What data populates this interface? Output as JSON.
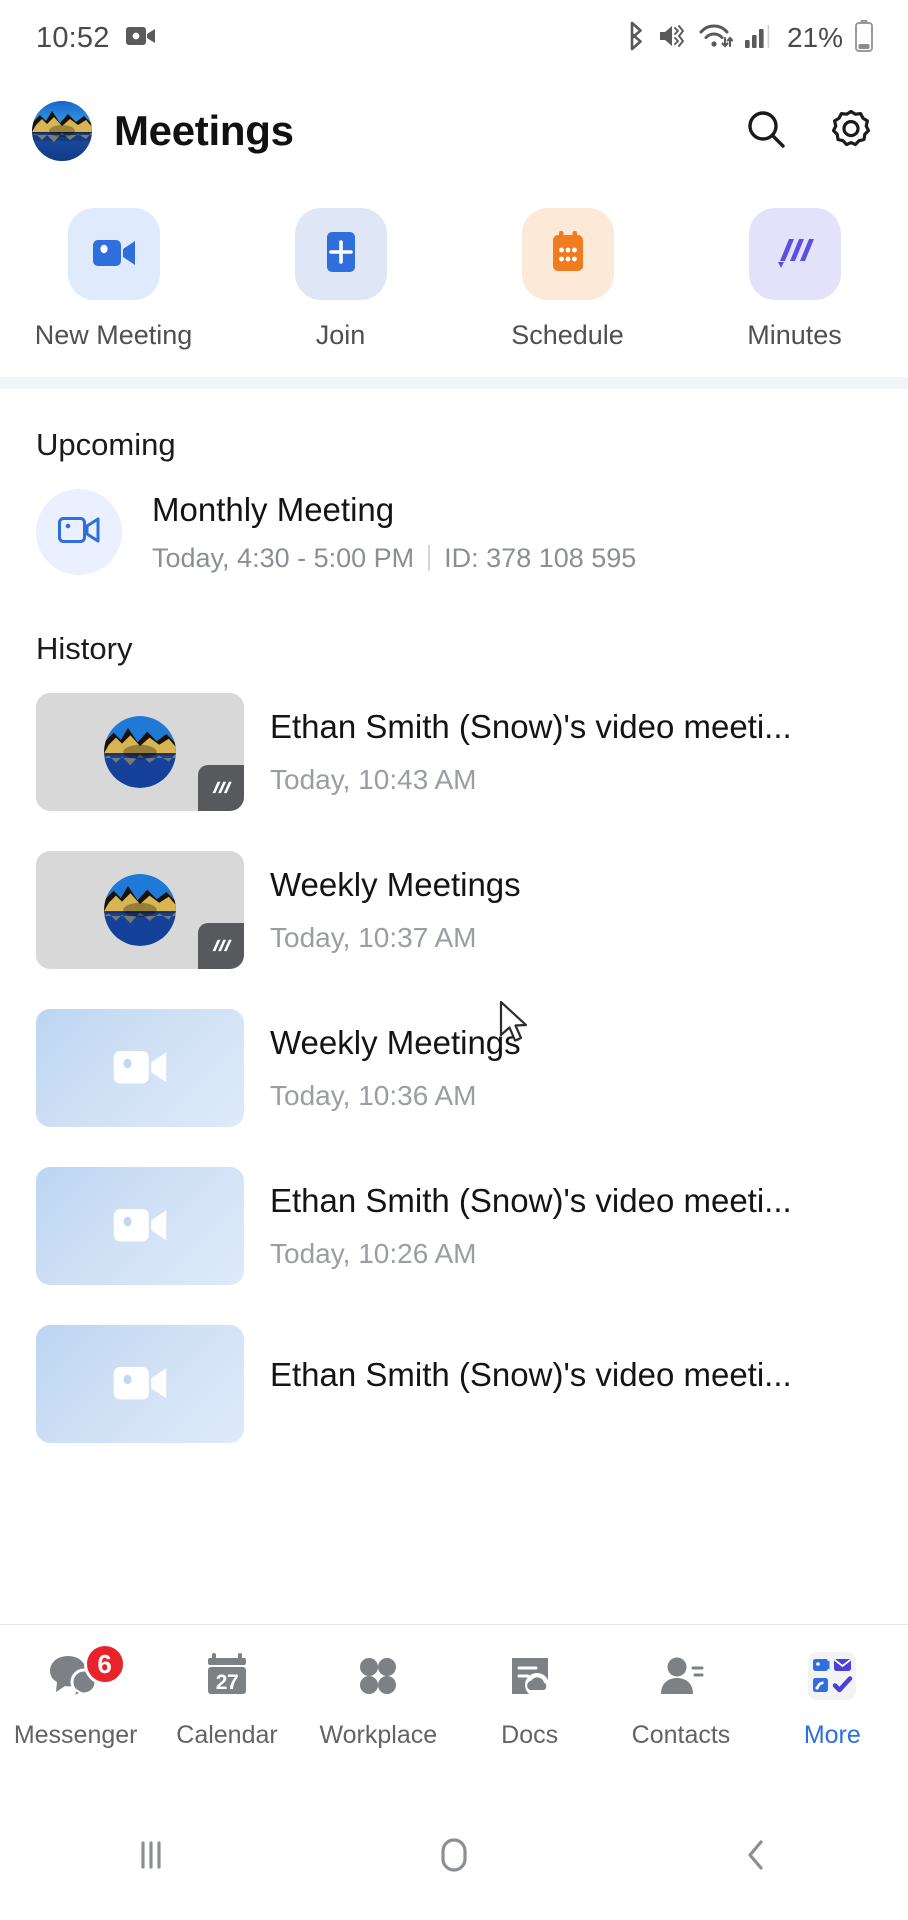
{
  "status_bar": {
    "time": "10:52",
    "battery_percent": "21%",
    "icons": [
      "video-recording-icon",
      "bluetooth-icon",
      "mute-vibrate-icon",
      "wifi-icon",
      "cellular-signal-icon",
      "battery-icon"
    ]
  },
  "header": {
    "title": "Meetings",
    "avatar_name": "user-avatar",
    "search_label": "search-icon",
    "settings_label": "gear-icon"
  },
  "quick_actions": [
    {
      "label": "New Meeting",
      "icon": "video-camera-icon",
      "tile_color": "#dfeafd",
      "icon_color": "#2f6fdd"
    },
    {
      "label": "Join",
      "icon": "plus-square-icon",
      "tile_color": "#dfe7f7",
      "icon_color": "#2f6fdd"
    },
    {
      "label": "Schedule",
      "icon": "calendar-icon",
      "tile_color": "#fde9d7",
      "icon_color": "#f07c1f"
    },
    {
      "label": "Minutes",
      "icon": "minutes-icon",
      "tile_color": "#e4e2fb",
      "icon_color": "#5b4fe0"
    }
  ],
  "upcoming": {
    "section_title": "Upcoming",
    "meeting": {
      "title": "Monthly Meeting",
      "time": "Today, 4:30 - 5:00 PM",
      "id": "ID: 378 108 595"
    }
  },
  "history": {
    "section_title": "History",
    "items": [
      {
        "title": "Ethan Smith (Snow)'s video meeti...",
        "time": "Today, 10:43 AM",
        "thumb": "gray",
        "has_avatar": true,
        "has_minutes_badge": true
      },
      {
        "title": "Weekly Meetings",
        "time": "Today, 10:37 AM",
        "thumb": "gray",
        "has_avatar": true,
        "has_minutes_badge": true
      },
      {
        "title": "Weekly Meetings",
        "time": "Today, 10:36 AM",
        "thumb": "blue",
        "has_avatar": false,
        "has_minutes_badge": false
      },
      {
        "title": "Ethan Smith (Snow)'s video meeti...",
        "time": "Today, 10:26 AM",
        "thumb": "blue",
        "has_avatar": false,
        "has_minutes_badge": false
      },
      {
        "title": "Ethan Smith (Snow)'s video meeti...",
        "time": "",
        "thumb": "blue",
        "has_avatar": false,
        "has_minutes_badge": false
      }
    ]
  },
  "bottom_nav": {
    "items": [
      {
        "label": "Messenger",
        "icon": "chat-bubbles-icon",
        "badge": "6",
        "active": false
      },
      {
        "label": "Calendar",
        "icon": "calendar-icon",
        "day_number": "27",
        "active": false
      },
      {
        "label": "Workplace",
        "icon": "grid-dots-icon",
        "active": false
      },
      {
        "label": "Docs",
        "icon": "docs-cloud-icon",
        "active": false
      },
      {
        "label": "Contacts",
        "icon": "person-icon",
        "active": false
      },
      {
        "label": "More",
        "icon": "more-apps-grid-icon",
        "active": true
      }
    ],
    "active_color": "#2f6fdd",
    "inactive_color": "#7d8186"
  },
  "system_nav": {
    "recents": "recents-icon",
    "home": "home-icon",
    "back": "back-icon"
  }
}
